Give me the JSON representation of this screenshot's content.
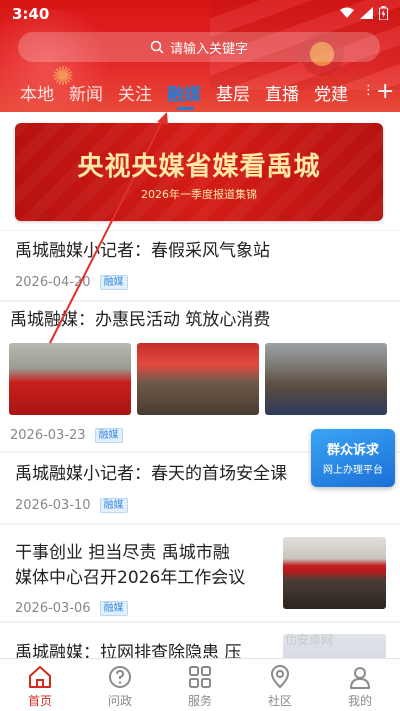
{
  "status": {
    "time": "3:40"
  },
  "search": {
    "placeholder": "请输入关键字"
  },
  "tabs": {
    "items": [
      "",
      "本地",
      "新闻",
      "关注",
      "融媒",
      "基层",
      "直播",
      "党建"
    ],
    "active_index": 4,
    "more": "+"
  },
  "banner": {
    "title": "央视央媒省媒看禹城",
    "subtitle": "2026年一季度报道集锦"
  },
  "news": [
    {
      "title": "禹城融媒小记者：春假采风气象站",
      "date": "2026-04-20",
      "tag": "融媒"
    },
    {
      "title": "禹城融媒：办惠民活动  筑放心消费",
      "date": "2026-03-23",
      "tag": "融媒"
    },
    {
      "title": "禹城融媒小记者：春天的首场安全课",
      "date": "2026-03-10",
      "tag": "融媒"
    },
    {
      "title_line1": "干事创业  担当尽责  禹城市融",
      "title_line2": "媒体中心召开2026年工作会议",
      "date": "2026-03-06",
      "tag": "融媒"
    },
    {
      "title": "禹城融媒：拉网排查除隐患  压"
    }
  ],
  "float_badge": {
    "line1": "群众诉求",
    "line2": "网上办理平台"
  },
  "watermark": "仂安卓网",
  "bottom_nav": [
    {
      "label": "首页",
      "icon": "home-icon"
    },
    {
      "label": "问政",
      "icon": "question-icon"
    },
    {
      "label": "服务",
      "icon": "grid-icon"
    },
    {
      "label": "社区",
      "icon": "location-icon"
    },
    {
      "label": "我的",
      "icon": "person-icon"
    }
  ],
  "colors": {
    "header_red": "#e02020",
    "accent_blue": "#1f7ed6",
    "active_nav_red": "#d42a1e",
    "annotation_arrow": "#e0302c"
  }
}
